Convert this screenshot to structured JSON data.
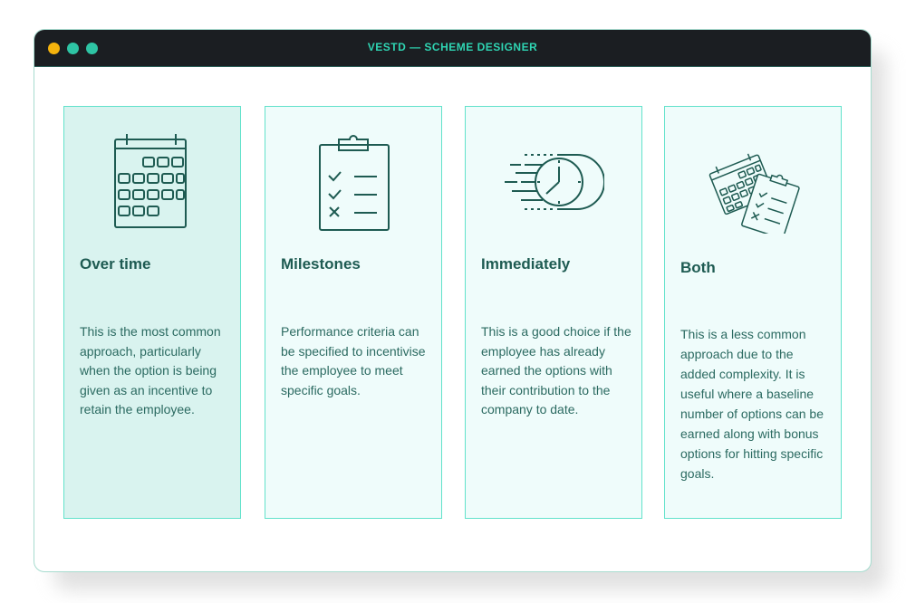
{
  "window": {
    "title": "VESTD — SCHEME DESIGNER"
  },
  "options": [
    {
      "label": "Over time",
      "description": "This is the most common approach, particularly when the option is being given as an incentive to retain the employee.",
      "icon": "calendar-icon",
      "selected": true
    },
    {
      "label": "Milestones",
      "description": "Performance criteria can be specified to incentivise the employee to meet specific goals.",
      "icon": "clipboard-checklist-icon",
      "selected": false
    },
    {
      "label": "Immediately",
      "description": "This is a good choice if the employee has already earned the options with their contribution to the company to date.",
      "icon": "fast-clock-icon",
      "selected": false
    },
    {
      "label": "Both",
      "description": "This is a less common approach due to the added complexity. It is useful where a baseline number of options can be earned along with bonus options for hitting specific goals.",
      "icon": "calendar-and-clipboard-icon",
      "selected": false
    }
  ],
  "colors": {
    "accent": "#2ec4a4",
    "heading": "#1e5b52",
    "titlebar": "#1b1e22",
    "card_border": "#62e2cb",
    "selected_bg": "#d9f3ef",
    "card_bg": "#effcfb"
  }
}
